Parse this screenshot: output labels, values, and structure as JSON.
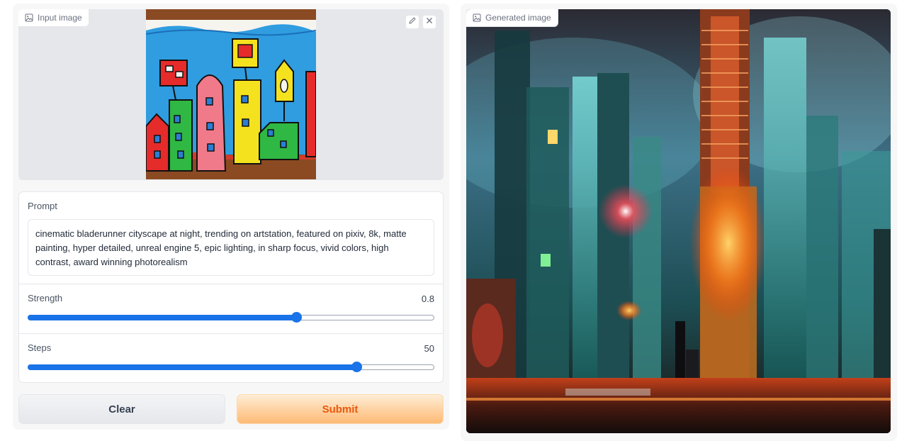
{
  "input_panel": {
    "label": "Input image",
    "icons": {
      "label_icon": "image-icon",
      "edit": "pencil-icon",
      "clear": "close-icon"
    }
  },
  "prompt": {
    "label": "Prompt",
    "value": "cinematic bladerunner cityscape at night, trending on artstation, featured on pixiv, 8k, matte painting, hyper detailed, unreal engine 5, epic lighting, in sharp focus, vivid colors, high contrast, award winning photorealism"
  },
  "strength": {
    "label": "Strength",
    "value": "0.8",
    "fraction": 0.66
  },
  "steps": {
    "label": "Steps",
    "value": "50",
    "fraction": 0.81
  },
  "buttons": {
    "clear": "Clear",
    "submit": "Submit"
  },
  "output_panel": {
    "label": "Generated image",
    "icons": {
      "label_icon": "image-icon"
    }
  },
  "colors": {
    "accent": "#1a73e8",
    "submit_text": "#ea580c",
    "submit_bg": "#fdba74"
  }
}
